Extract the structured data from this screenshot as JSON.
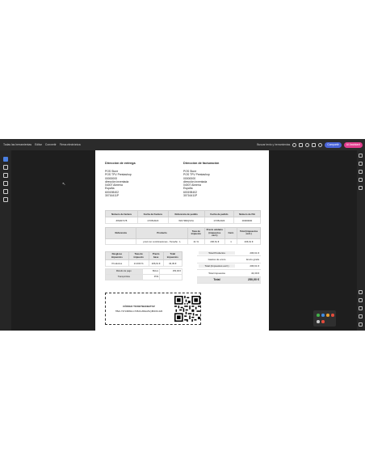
{
  "menubar": {
    "items": [
      "Todas las herramientas",
      "Editar",
      "Convertir",
      "Firma electrónica"
    ],
    "search_placeholder": "Buscar texto y herramientas",
    "share_label": "Compartir",
    "ai_label": "AI Assistant"
  },
  "document": {
    "shipping": {
      "title": "Dirección de entrega",
      "lines": [
        "POS Store",
        "POS TPV Prestashop",
        "00000000",
        "dirección inventada",
        "04007 Almería",
        "España",
        "600198402",
        "30716411P"
      ]
    },
    "billing": {
      "title": "Dirección de facturación",
      "lines": [
        "POS Store",
        "POS TPV Prestashop",
        "00000000",
        "dirección inventada",
        "04007 Almería",
        "España",
        "600198402",
        "30716411P"
      ]
    },
    "invoice_table": {
      "headers": [
        "Número de factura",
        "Fecha de Factura",
        "Referencia de pedido",
        "Fecha de pedido",
        "Número de IVA"
      ],
      "row": [
        "#IN007178",
        "17/05/2023",
        "WKYMDQVXA",
        "17/05/2023",
        "00000000"
      ]
    },
    "items_table": {
      "headers": [
        "Referencia",
        "Producto",
        "Tasa de impuesto",
        "Precio unidario (impuestos excl.)",
        "Cant.",
        "Total (impuestos excl.)"
      ],
      "row": [
        "",
        "prod con combinaciones - Tamaño : L",
        "21 %",
        "206,61 €",
        "1",
        "206,61 €"
      ]
    },
    "tax_table": {
      "headers": [
        "Desglose impuestos",
        "Tasa de impuesto",
        "Precio base",
        "Total impuestos"
      ],
      "row": [
        "Productos",
        "21.000 %",
        "206,61 €",
        "43,39 €"
      ]
    },
    "payment_table": {
      "rows": [
        {
          "label": "Método de pago",
          "value": "Bizum",
          "amount": "250,00 €"
        },
        {
          "label": "Transportista",
          "value": "POS",
          "amount": ""
        }
      ]
    },
    "totals": {
      "rows": [
        {
          "label": "Total Productos",
          "value": "206,61 €"
        },
        {
          "label": "Gastos de envío",
          "value": "Envío gratis"
        },
        {
          "label": "Total (Impuestos excl.)",
          "value": "206,61 €"
        },
        {
          "label": "Total impuestos",
          "value": "43,39 €"
        }
      ],
      "final_label": "Total",
      "final_value": "250,00 €"
    },
    "verifactu": {
      "title": "CÓDIGO TICKETBAI/BATUZ",
      "code": "TBAI-73713680A-170523-ZRHA6VyBNOK-026"
    }
  }
}
